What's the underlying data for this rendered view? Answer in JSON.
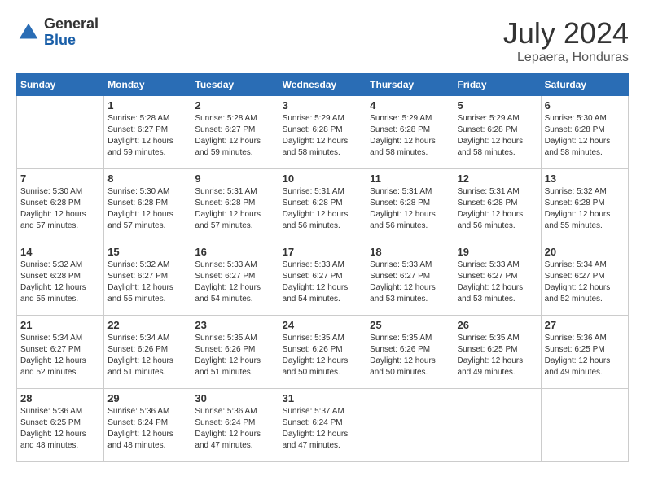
{
  "header": {
    "logo": {
      "general": "General",
      "blue": "Blue"
    },
    "title": "July 2024",
    "location": "Lepaera, Honduras"
  },
  "calendar": {
    "days_of_week": [
      "Sunday",
      "Monday",
      "Tuesday",
      "Wednesday",
      "Thursday",
      "Friday",
      "Saturday"
    ],
    "weeks": [
      [
        {
          "day": "",
          "sunrise": "",
          "sunset": "",
          "daylight": ""
        },
        {
          "day": "1",
          "sunrise": "Sunrise: 5:28 AM",
          "sunset": "Sunset: 6:27 PM",
          "daylight": "Daylight: 12 hours and 59 minutes."
        },
        {
          "day": "2",
          "sunrise": "Sunrise: 5:28 AM",
          "sunset": "Sunset: 6:27 PM",
          "daylight": "Daylight: 12 hours and 59 minutes."
        },
        {
          "day": "3",
          "sunrise": "Sunrise: 5:29 AM",
          "sunset": "Sunset: 6:28 PM",
          "daylight": "Daylight: 12 hours and 58 minutes."
        },
        {
          "day": "4",
          "sunrise": "Sunrise: 5:29 AM",
          "sunset": "Sunset: 6:28 PM",
          "daylight": "Daylight: 12 hours and 58 minutes."
        },
        {
          "day": "5",
          "sunrise": "Sunrise: 5:29 AM",
          "sunset": "Sunset: 6:28 PM",
          "daylight": "Daylight: 12 hours and 58 minutes."
        },
        {
          "day": "6",
          "sunrise": "Sunrise: 5:30 AM",
          "sunset": "Sunset: 6:28 PM",
          "daylight": "Daylight: 12 hours and 58 minutes."
        }
      ],
      [
        {
          "day": "7",
          "sunrise": "Sunrise: 5:30 AM",
          "sunset": "Sunset: 6:28 PM",
          "daylight": "Daylight: 12 hours and 57 minutes."
        },
        {
          "day": "8",
          "sunrise": "Sunrise: 5:30 AM",
          "sunset": "Sunset: 6:28 PM",
          "daylight": "Daylight: 12 hours and 57 minutes."
        },
        {
          "day": "9",
          "sunrise": "Sunrise: 5:31 AM",
          "sunset": "Sunset: 6:28 PM",
          "daylight": "Daylight: 12 hours and 57 minutes."
        },
        {
          "day": "10",
          "sunrise": "Sunrise: 5:31 AM",
          "sunset": "Sunset: 6:28 PM",
          "daylight": "Daylight: 12 hours and 56 minutes."
        },
        {
          "day": "11",
          "sunrise": "Sunrise: 5:31 AM",
          "sunset": "Sunset: 6:28 PM",
          "daylight": "Daylight: 12 hours and 56 minutes."
        },
        {
          "day": "12",
          "sunrise": "Sunrise: 5:31 AM",
          "sunset": "Sunset: 6:28 PM",
          "daylight": "Daylight: 12 hours and 56 minutes."
        },
        {
          "day": "13",
          "sunrise": "Sunrise: 5:32 AM",
          "sunset": "Sunset: 6:28 PM",
          "daylight": "Daylight: 12 hours and 55 minutes."
        }
      ],
      [
        {
          "day": "14",
          "sunrise": "Sunrise: 5:32 AM",
          "sunset": "Sunset: 6:28 PM",
          "daylight": "Daylight: 12 hours and 55 minutes."
        },
        {
          "day": "15",
          "sunrise": "Sunrise: 5:32 AM",
          "sunset": "Sunset: 6:27 PM",
          "daylight": "Daylight: 12 hours and 55 minutes."
        },
        {
          "day": "16",
          "sunrise": "Sunrise: 5:33 AM",
          "sunset": "Sunset: 6:27 PM",
          "daylight": "Daylight: 12 hours and 54 minutes."
        },
        {
          "day": "17",
          "sunrise": "Sunrise: 5:33 AM",
          "sunset": "Sunset: 6:27 PM",
          "daylight": "Daylight: 12 hours and 54 minutes."
        },
        {
          "day": "18",
          "sunrise": "Sunrise: 5:33 AM",
          "sunset": "Sunset: 6:27 PM",
          "daylight": "Daylight: 12 hours and 53 minutes."
        },
        {
          "day": "19",
          "sunrise": "Sunrise: 5:33 AM",
          "sunset": "Sunset: 6:27 PM",
          "daylight": "Daylight: 12 hours and 53 minutes."
        },
        {
          "day": "20",
          "sunrise": "Sunrise: 5:34 AM",
          "sunset": "Sunset: 6:27 PM",
          "daylight": "Daylight: 12 hours and 52 minutes."
        }
      ],
      [
        {
          "day": "21",
          "sunrise": "Sunrise: 5:34 AM",
          "sunset": "Sunset: 6:27 PM",
          "daylight": "Daylight: 12 hours and 52 minutes."
        },
        {
          "day": "22",
          "sunrise": "Sunrise: 5:34 AM",
          "sunset": "Sunset: 6:26 PM",
          "daylight": "Daylight: 12 hours and 51 minutes."
        },
        {
          "day": "23",
          "sunrise": "Sunrise: 5:35 AM",
          "sunset": "Sunset: 6:26 PM",
          "daylight": "Daylight: 12 hours and 51 minutes."
        },
        {
          "day": "24",
          "sunrise": "Sunrise: 5:35 AM",
          "sunset": "Sunset: 6:26 PM",
          "daylight": "Daylight: 12 hours and 50 minutes."
        },
        {
          "day": "25",
          "sunrise": "Sunrise: 5:35 AM",
          "sunset": "Sunset: 6:26 PM",
          "daylight": "Daylight: 12 hours and 50 minutes."
        },
        {
          "day": "26",
          "sunrise": "Sunrise: 5:35 AM",
          "sunset": "Sunset: 6:25 PM",
          "daylight": "Daylight: 12 hours and 49 minutes."
        },
        {
          "day": "27",
          "sunrise": "Sunrise: 5:36 AM",
          "sunset": "Sunset: 6:25 PM",
          "daylight": "Daylight: 12 hours and 49 minutes."
        }
      ],
      [
        {
          "day": "28",
          "sunrise": "Sunrise: 5:36 AM",
          "sunset": "Sunset: 6:25 PM",
          "daylight": "Daylight: 12 hours and 48 minutes."
        },
        {
          "day": "29",
          "sunrise": "Sunrise: 5:36 AM",
          "sunset": "Sunset: 6:24 PM",
          "daylight": "Daylight: 12 hours and 48 minutes."
        },
        {
          "day": "30",
          "sunrise": "Sunrise: 5:36 AM",
          "sunset": "Sunset: 6:24 PM",
          "daylight": "Daylight: 12 hours and 47 minutes."
        },
        {
          "day": "31",
          "sunrise": "Sunrise: 5:37 AM",
          "sunset": "Sunset: 6:24 PM",
          "daylight": "Daylight: 12 hours and 47 minutes."
        },
        {
          "day": "",
          "sunrise": "",
          "sunset": "",
          "daylight": ""
        },
        {
          "day": "",
          "sunrise": "",
          "sunset": "",
          "daylight": ""
        },
        {
          "day": "",
          "sunrise": "",
          "sunset": "",
          "daylight": ""
        }
      ]
    ]
  }
}
